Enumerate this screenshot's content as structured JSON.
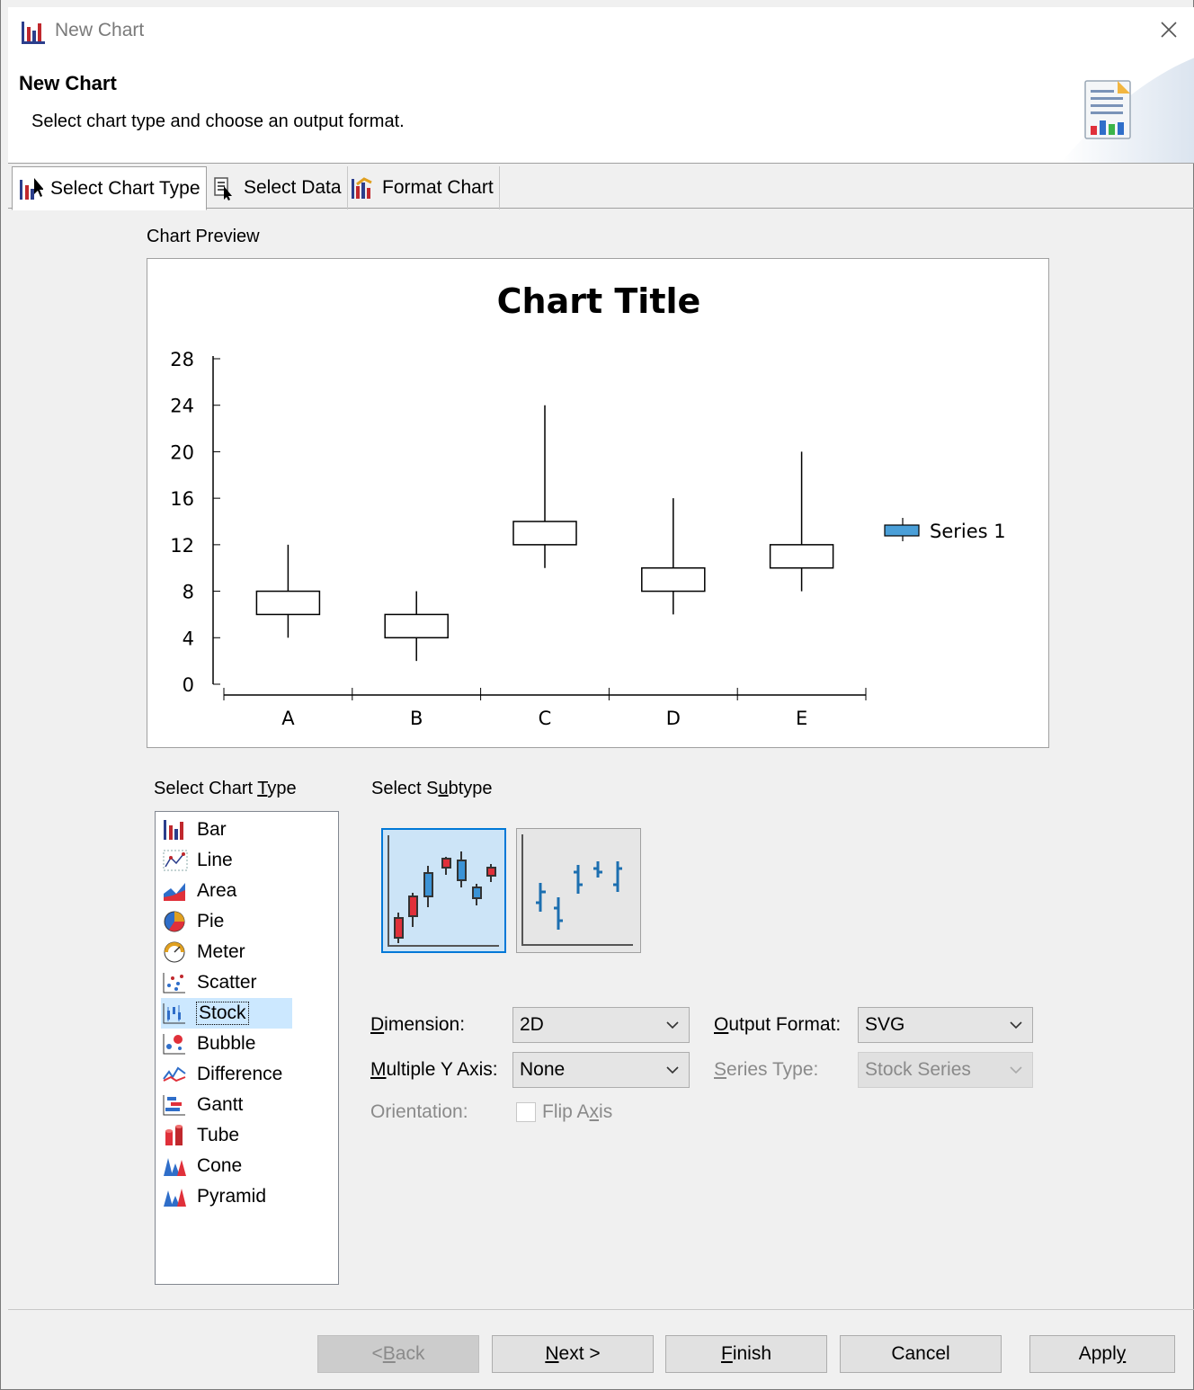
{
  "window": {
    "title": "New Chart"
  },
  "header": {
    "heading": "New Chart",
    "description": "Select chart type and choose an output format."
  },
  "tabs": [
    {
      "label": "Select Chart Type",
      "icon": "chart-type-icon",
      "active": true
    },
    {
      "label": "Select Data",
      "icon": "select-data-icon",
      "active": false
    },
    {
      "label": "Format Chart",
      "icon": "format-chart-icon",
      "active": false
    }
  ],
  "preview": {
    "label": "Chart Preview"
  },
  "chart_data": {
    "type": "stock",
    "title": "Chart Title",
    "categories": [
      "A",
      "B",
      "C",
      "D",
      "E"
    ],
    "series": [
      {
        "name": "Series 1",
        "candles": [
          {
            "low": 4,
            "open": 6,
            "close": 8,
            "high": 12
          },
          {
            "low": 2,
            "open": 4,
            "close": 6,
            "high": 8
          },
          {
            "low": 10,
            "open": 12,
            "close": 14,
            "high": 24
          },
          {
            "low": 6,
            "open": 8,
            "close": 10,
            "high": 16
          },
          {
            "low": 8,
            "open": 10,
            "close": 12,
            "high": 20
          }
        ]
      }
    ],
    "ylim": [
      0,
      28
    ],
    "yticks": [
      "0",
      "4",
      "8",
      "12",
      "16",
      "20",
      "24",
      "28"
    ],
    "legend_position": "right",
    "grid": false,
    "colors": {
      "legend_swatch": "#4a9fd8"
    }
  },
  "chart_types": {
    "label_prefix": "Select Chart ",
    "label_mnemonic": "T",
    "label_suffix": "ype",
    "items": [
      {
        "label": "Bar",
        "icon": "bar-chart-icon"
      },
      {
        "label": "Line",
        "icon": "line-chart-icon"
      },
      {
        "label": "Area",
        "icon": "area-chart-icon"
      },
      {
        "label": "Pie",
        "icon": "pie-chart-icon"
      },
      {
        "label": "Meter",
        "icon": "meter-chart-icon"
      },
      {
        "label": "Scatter",
        "icon": "scatter-chart-icon"
      },
      {
        "label": "Stock",
        "icon": "stock-chart-icon",
        "selected": true
      },
      {
        "label": "Bubble",
        "icon": "bubble-chart-icon"
      },
      {
        "label": "Difference",
        "icon": "difference-chart-icon"
      },
      {
        "label": "Gantt",
        "icon": "gantt-chart-icon"
      },
      {
        "label": "Tube",
        "icon": "tube-chart-icon"
      },
      {
        "label": "Cone",
        "icon": "cone-chart-icon"
      },
      {
        "label": "Pyramid",
        "icon": "pyramid-chart-icon"
      }
    ]
  },
  "subtype": {
    "label_prefix": "Select S",
    "label_mnemonic": "u",
    "label_suffix": "btype",
    "options": [
      {
        "name": "candlestick-subtype",
        "selected": true
      },
      {
        "name": "hlc-stick-subtype",
        "selected": false
      }
    ]
  },
  "form": {
    "dimension": {
      "mnemonic": "D",
      "rest": "imension:",
      "value": "2D"
    },
    "multiple_y_axis": {
      "mnemonic": "M",
      "rest": "ultiple Y Axis:",
      "value": "None"
    },
    "orientation": {
      "label": "Orientation:",
      "checkbox_prefix": "Flip A",
      "checkbox_mnemonic": "x",
      "checkbox_suffix": "is",
      "checked": false
    },
    "output_format": {
      "mnemonic": "O",
      "rest": "utput Format:",
      "value": "SVG"
    },
    "series_type": {
      "mnemonic": "S",
      "rest": "eries Type:",
      "value": "Stock Series"
    }
  },
  "buttons": {
    "back": {
      "prefix": "< ",
      "mnemonic": "B",
      "rest": "ack"
    },
    "next": {
      "mnemonic": "N",
      "rest": "ext >"
    },
    "finish": {
      "mnemonic": "F",
      "rest": "inish"
    },
    "cancel": {
      "label": "Cancel"
    },
    "apply": {
      "prefix": "Appl",
      "mnemonic": "y"
    }
  }
}
